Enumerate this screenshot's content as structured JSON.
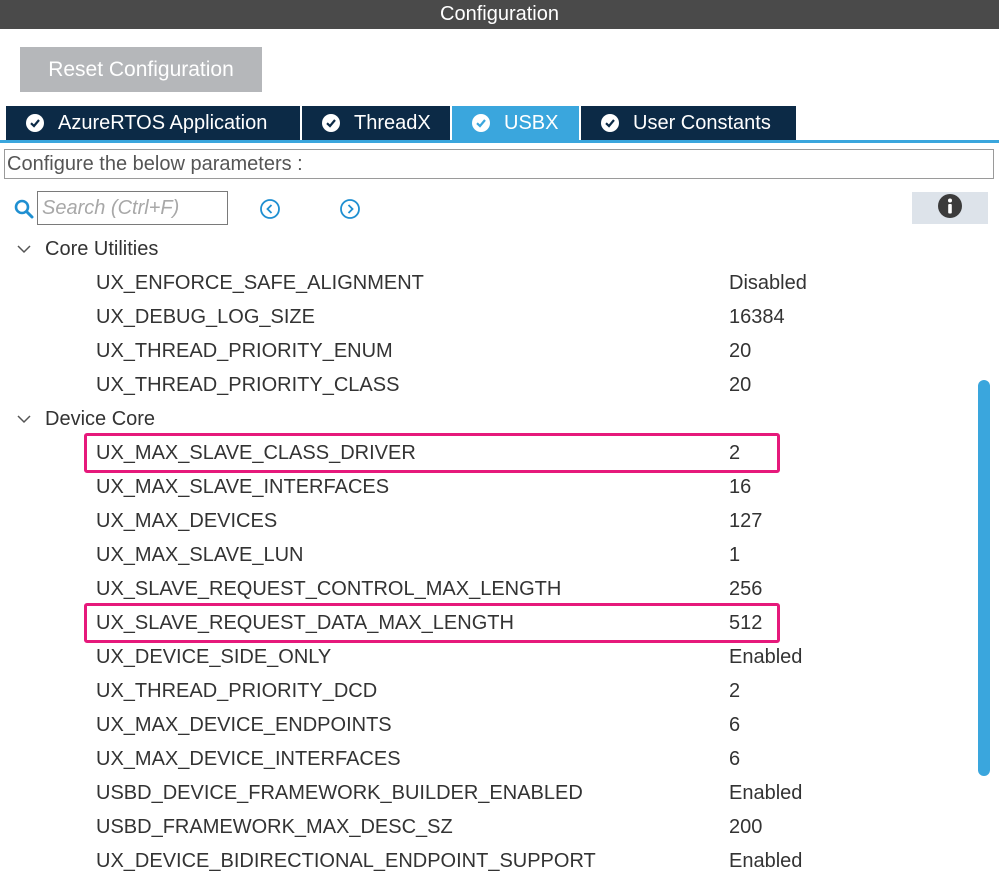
{
  "title": "Configuration",
  "reset_label": "Reset Configuration",
  "tabs": [
    {
      "label": "AzureRTOS Application",
      "active": false
    },
    {
      "label": "ThreadX",
      "active": false
    },
    {
      "label": "USBX",
      "active": true
    },
    {
      "label": "User Constants",
      "active": false
    }
  ],
  "params_header": "Configure the below parameters :",
  "search": {
    "placeholder": "Search (Ctrl+F)"
  },
  "icons": {
    "search": "search-icon",
    "prev": "circle-chevron-left-icon",
    "next": "circle-chevron-right-icon",
    "info": "info-icon",
    "group_expander": "chevron-down-icon",
    "tab_status": "check-circle-icon"
  },
  "colors": {
    "title_bar": "#4a4a4a",
    "tab_inactive": "#0c2a46",
    "tab_active": "#3aa6dd",
    "highlight": "#e6197b",
    "reset_button": "#b5b7ba"
  },
  "groups": [
    {
      "name": "Core Utilities",
      "params": [
        {
          "name": "UX_ENFORCE_SAFE_ALIGNMENT",
          "value": "Disabled"
        },
        {
          "name": "UX_DEBUG_LOG_SIZE",
          "value": "16384"
        },
        {
          "name": "UX_THREAD_PRIORITY_ENUM",
          "value": "20"
        },
        {
          "name": "UX_THREAD_PRIORITY_CLASS",
          "value": "20"
        }
      ]
    },
    {
      "name": "Device Core",
      "params": [
        {
          "name": "UX_MAX_SLAVE_CLASS_DRIVER",
          "value": "2",
          "highlighted": true
        },
        {
          "name": "UX_MAX_SLAVE_INTERFACES",
          "value": "16"
        },
        {
          "name": "UX_MAX_DEVICES",
          "value": "127"
        },
        {
          "name": "UX_MAX_SLAVE_LUN",
          "value": "1"
        },
        {
          "name": "UX_SLAVE_REQUEST_CONTROL_MAX_LENGTH",
          "value": "256"
        },
        {
          "name": "UX_SLAVE_REQUEST_DATA_MAX_LENGTH",
          "value": "512",
          "highlighted": true
        },
        {
          "name": "UX_DEVICE_SIDE_ONLY",
          "value": "Enabled"
        },
        {
          "name": "UX_THREAD_PRIORITY_DCD",
          "value": "2"
        },
        {
          "name": "UX_MAX_DEVICE_ENDPOINTS",
          "value": "6"
        },
        {
          "name": "UX_MAX_DEVICE_INTERFACES",
          "value": "6"
        },
        {
          "name": "USBD_DEVICE_FRAMEWORK_BUILDER_ENABLED",
          "value": "Enabled"
        },
        {
          "name": "USBD_FRAMEWORK_MAX_DESC_SZ",
          "value": "200"
        },
        {
          "name": "UX_DEVICE_BIDIRECTIONAL_ENDPOINT_SUPPORT",
          "value": "Enabled"
        }
      ]
    }
  ]
}
